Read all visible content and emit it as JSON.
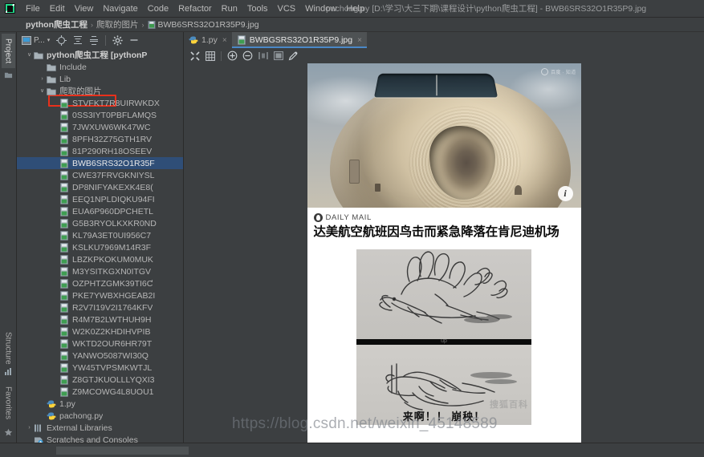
{
  "window": {
    "title": "pachong.py [D:\\学习\\大三下期\\课程设计\\python爬虫工程] - BWB6SRS32O1R35P9.jpg",
    "logo_name": "pycharm-logo"
  },
  "menubar": {
    "items": [
      {
        "label": "File"
      },
      {
        "label": "Edit"
      },
      {
        "label": "View"
      },
      {
        "label": "Navigate"
      },
      {
        "label": "Code"
      },
      {
        "label": "Refactor"
      },
      {
        "label": "Run"
      },
      {
        "label": "Tools"
      },
      {
        "label": "VCS"
      },
      {
        "label": "Window"
      },
      {
        "label": "Help"
      }
    ]
  },
  "breadcrumb": {
    "project": "python爬虫工程",
    "folder": "爬取的图片",
    "file": "BWB6SRS32O1R35P9.jpg",
    "separator": "›"
  },
  "tool_strip": {
    "top_tab": "Project",
    "bottom_tabs": [
      "Structure",
      "Favorites"
    ]
  },
  "project_panel": {
    "toolbar": {
      "view_selector": "P...",
      "view_selector_caret": "▾",
      "locate_icon": "crosshair-icon",
      "expand_icon": "expand-all-icon",
      "collapse_icon": "collapse-all-icon",
      "settings_icon": "gear-icon",
      "hide_icon": "hide-panel-icon"
    },
    "tree": [
      {
        "depth": 0,
        "arrow": "∨",
        "icon": "folder",
        "label": "python爬虫工程 [pythonP",
        "bold": true,
        "selected": false
      },
      {
        "depth": 1,
        "arrow": "",
        "icon": "folder",
        "label": "Include",
        "bold": false,
        "selected": false
      },
      {
        "depth": 1,
        "arrow": "›",
        "icon": "folder",
        "label": "Lib",
        "bold": false,
        "selected": false
      },
      {
        "depth": 1,
        "arrow": "∨",
        "icon": "folder",
        "label": "爬取的图片",
        "bold": false,
        "selected": false,
        "highlight": true
      },
      {
        "depth": 2,
        "arrow": "",
        "icon": "image",
        "label": "STVFKT7R8UIRWKDX",
        "bold": false,
        "selected": false
      },
      {
        "depth": 2,
        "arrow": "",
        "icon": "image",
        "label": "0SS3IYT0PBFLAMQS",
        "bold": false,
        "selected": false
      },
      {
        "depth": 2,
        "arrow": "",
        "icon": "image",
        "label": "7JWXUW6WK47WC",
        "bold": false,
        "selected": false
      },
      {
        "depth": 2,
        "arrow": "",
        "icon": "image",
        "label": "8PFH32Z75GTH1RV",
        "bold": false,
        "selected": false
      },
      {
        "depth": 2,
        "arrow": "",
        "icon": "image",
        "label": "81P290RH18OSEEV",
        "bold": false,
        "selected": false
      },
      {
        "depth": 2,
        "arrow": "",
        "icon": "image",
        "label": "BWB6SRS32O1R35F",
        "bold": false,
        "selected": true
      },
      {
        "depth": 2,
        "arrow": "",
        "icon": "image",
        "label": "CWE37FRVGKNIYSL",
        "bold": false,
        "selected": false
      },
      {
        "depth": 2,
        "arrow": "",
        "icon": "image",
        "label": "DP8NIFYAKEXK4E8(",
        "bold": false,
        "selected": false
      },
      {
        "depth": 2,
        "arrow": "",
        "icon": "image",
        "label": "EEQ1NPLDIQKU94FI",
        "bold": false,
        "selected": false
      },
      {
        "depth": 2,
        "arrow": "",
        "icon": "image",
        "label": "EUA6P960DPCHETL",
        "bold": false,
        "selected": false
      },
      {
        "depth": 2,
        "arrow": "",
        "icon": "image",
        "label": "G5B3RYOLKXKR0ND",
        "bold": false,
        "selected": false
      },
      {
        "depth": 2,
        "arrow": "",
        "icon": "image",
        "label": "KL79A3ET0UI956C7",
        "bold": false,
        "selected": false
      },
      {
        "depth": 2,
        "arrow": "",
        "icon": "image",
        "label": "KSLKU7969M14R3F",
        "bold": false,
        "selected": false
      },
      {
        "depth": 2,
        "arrow": "",
        "icon": "image",
        "label": "LBZKPKOKUM0MUK",
        "bold": false,
        "selected": false
      },
      {
        "depth": 2,
        "arrow": "",
        "icon": "image",
        "label": "M3YSITKGXN0ITGV",
        "bold": false,
        "selected": false
      },
      {
        "depth": 2,
        "arrow": "",
        "icon": "image",
        "label": "OZPHTZGMK39TI6Ƈ",
        "bold": false,
        "selected": false
      },
      {
        "depth": 2,
        "arrow": "",
        "icon": "image",
        "label": "PKE7YWBXHGEAB2I",
        "bold": false,
        "selected": false
      },
      {
        "depth": 2,
        "arrow": "",
        "icon": "image",
        "label": "R2V7I19V2I1764KFV",
        "bold": false,
        "selected": false
      },
      {
        "depth": 2,
        "arrow": "",
        "icon": "image",
        "label": "R4M7B2LWTHUH9H",
        "bold": false,
        "selected": false
      },
      {
        "depth": 2,
        "arrow": "",
        "icon": "image",
        "label": "W2K0Z2KHDIHVPIB",
        "bold": false,
        "selected": false
      },
      {
        "depth": 2,
        "arrow": "",
        "icon": "image",
        "label": "WKTD2OUR6HR79T",
        "bold": false,
        "selected": false
      },
      {
        "depth": 2,
        "arrow": "",
        "icon": "image",
        "label": "YANWO5087WI30Q",
        "bold": false,
        "selected": false
      },
      {
        "depth": 2,
        "arrow": "",
        "icon": "image",
        "label": "YW45TVPSMKWTJL",
        "bold": false,
        "selected": false
      },
      {
        "depth": 2,
        "arrow": "",
        "icon": "image",
        "label": "Z8GTJKUOLLLYQXI3",
        "bold": false,
        "selected": false
      },
      {
        "depth": 2,
        "arrow": "",
        "icon": "image",
        "label": "Z9MCOWG4L8UOU1",
        "bold": false,
        "selected": false
      },
      {
        "depth": 1,
        "arrow": "",
        "icon": "python",
        "label": "1.py",
        "bold": false,
        "selected": false
      },
      {
        "depth": 1,
        "arrow": "",
        "icon": "python",
        "label": "pachong.py",
        "bold": false,
        "selected": false
      },
      {
        "depth": 0,
        "arrow": "›",
        "icon": "library",
        "label": "External Libraries",
        "bold": false,
        "selected": false
      },
      {
        "depth": 0,
        "arrow": "",
        "icon": "scratch",
        "label": "Scratches and Consoles",
        "bold": false,
        "selected": false
      }
    ]
  },
  "editor": {
    "tabs": [
      {
        "label": "1.py",
        "icon": "python-file-icon",
        "active": false,
        "close": "×"
      },
      {
        "label": "BWBGSRS32O1R35P9.jpg",
        "icon": "image-file-icon",
        "active": true,
        "close": "×"
      }
    ],
    "image_toolbar": [
      {
        "name": "fit-to-window-icon"
      },
      {
        "name": "grid-icon"
      },
      {
        "name": "zoom-in-icon"
      },
      {
        "name": "zoom-out-icon"
      },
      {
        "name": "actual-size-icon"
      },
      {
        "name": "transparency-icon"
      },
      {
        "name": "color-picker-icon"
      }
    ]
  },
  "image_content": {
    "photo_alt": "damaged-aircraft-nose-cone",
    "top_watermark": "百度 · 知道",
    "info_button": "i",
    "source_logo": "daily-mail-logo",
    "source_name": "DAILY MAIL",
    "headline": "达美航空航班因鸟击而紧急降落在肯尼迪机场",
    "sketch_divider_label": "up",
    "sketch_caption": "来啊！！ 崩秧！",
    "sketch_watermark": "搜狐百科",
    "csdn_watermark": "https://blog.csdn.net/weixin_45148589"
  },
  "colors": {
    "bg": "#3c3f41",
    "panel_border": "#2b2b2b",
    "selection": "#2f4e77",
    "tab_active": "#4e5254",
    "tab_underline": "#4a88c7",
    "annotation_red": "#e8301b",
    "text": "#bbbbbb"
  }
}
